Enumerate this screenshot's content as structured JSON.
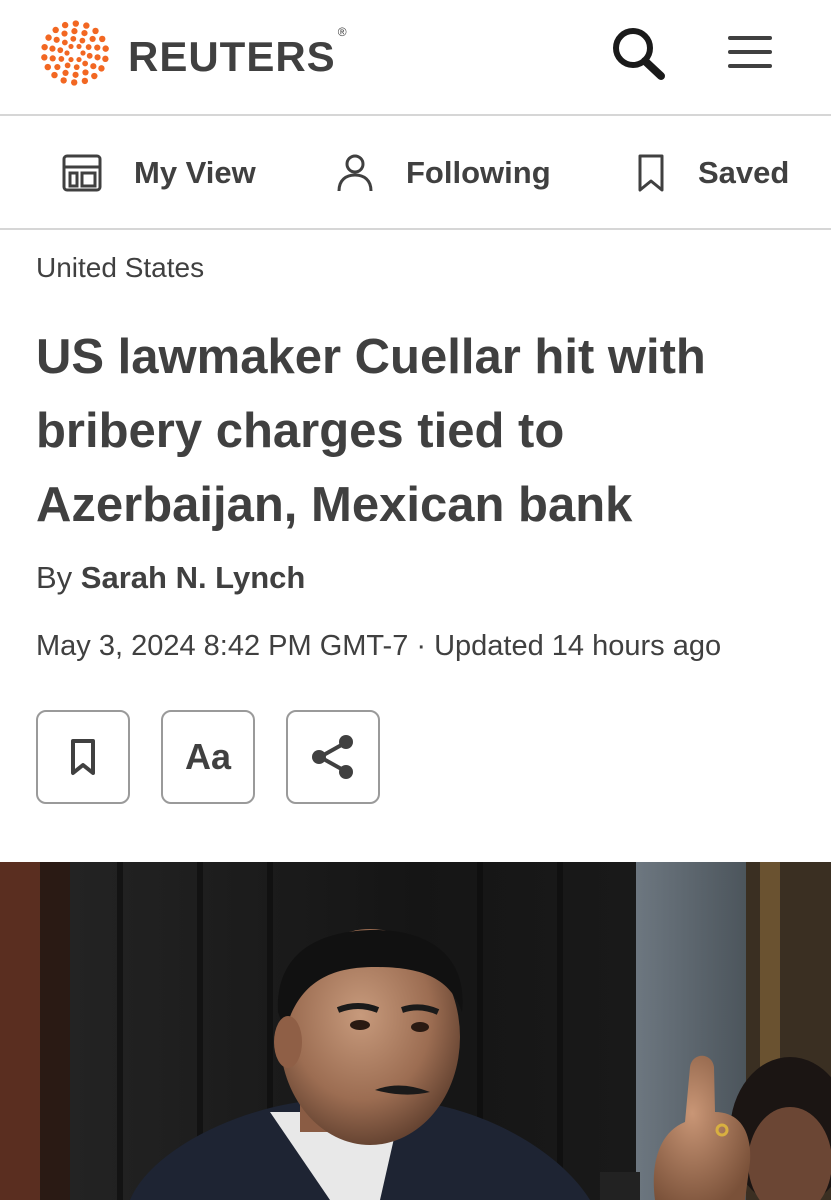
{
  "header": {
    "brand": "REUTERS",
    "registered": "®",
    "logo_icon": "reuters-dot-logo",
    "search_icon": "search-icon",
    "menu_icon": "hamburger-menu-icon",
    "accent_color": "#f26722"
  },
  "nav": {
    "items": [
      {
        "label": "My View",
        "icon": "layout-icon"
      },
      {
        "label": "Following",
        "icon": "person-icon"
      },
      {
        "label": "Saved",
        "icon": "bookmark-icon"
      }
    ]
  },
  "article": {
    "section": "United States",
    "headline": "US lawmaker Cuellar hit with bribery charges tied to Azerbaijan, Mexican bank",
    "by_prefix": "By ",
    "author": "Sarah N. Lynch",
    "dateline": "May 3, 2024 8:42 PM GMT-7 · Updated 14 hours ago",
    "tools": {
      "bookmark_icon": "bookmark-icon",
      "text_size_label": "Aa",
      "share_icon": "share-icon"
    },
    "photo": {
      "description_icon": "article-photo"
    }
  }
}
